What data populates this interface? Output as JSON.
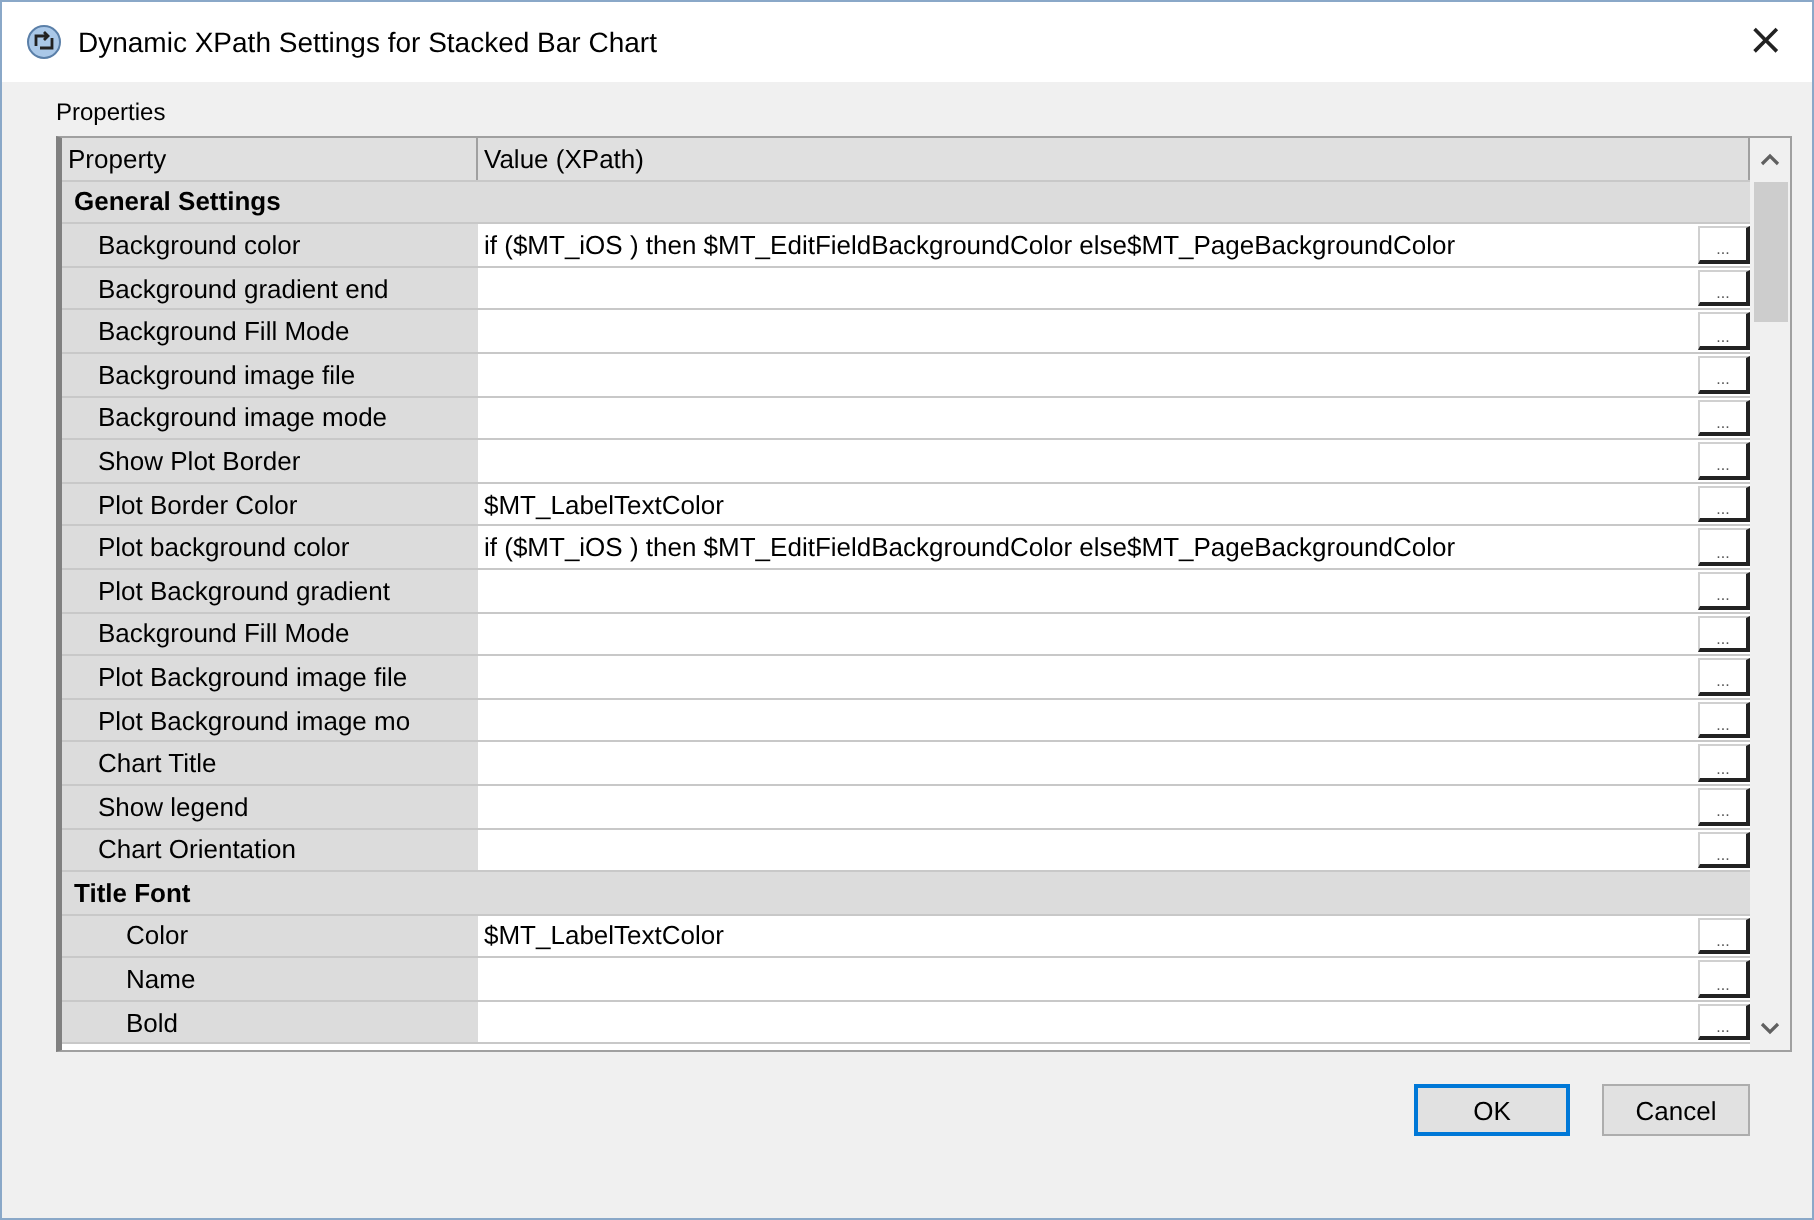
{
  "window": {
    "title": "Dynamic XPath Settings for Stacked Bar Chart",
    "close": "×"
  },
  "panel_label": "Properties",
  "table": {
    "columns": [
      "Property",
      "Value (XPath)"
    ],
    "sections": [
      {
        "title": "General Settings",
        "children": [
          {
            "property": "Background color",
            "value": "if ($MT_iOS ) then $MT_EditFieldBackgroundColor else$MT_PageBackgroundColor",
            "button": "..."
          },
          {
            "property": "Background gradient end",
            "button": "..."
          },
          {
            "property": "Background Fill Mode",
            "button": "..."
          },
          {
            "property": "Background image file",
            "button": "..."
          },
          {
            "property": "Background image mode",
            "button": "..."
          },
          {
            "property": "Show Plot Border",
            "button": "..."
          },
          {
            "property": "Plot Border Color",
            "value": "$MT_LabelTextColor",
            "button": "..."
          },
          {
            "property": "Plot background color",
            "value": "if ($MT_iOS ) then $MT_EditFieldBackgroundColor else$MT_PageBackgroundColor",
            "button": "..."
          },
          {
            "property": "Plot Background gradient",
            "button": "..."
          },
          {
            "property": "Background Fill Mode",
            "button": "..."
          },
          {
            "property": "Plot Background image file",
            "button": "..."
          },
          {
            "property": "Plot Background image mo",
            "button": "..."
          },
          {
            "property": "Chart Title",
            "button": "..."
          },
          {
            "property": "Show legend",
            "button": "..."
          },
          {
            "property": "Chart Orientation",
            "button": "..."
          }
        ]
      },
      {
        "title": "Title Font",
        "children": [
          {
            "property": "Color",
            "value": "$MT_LabelTextColor",
            "button": "..."
          },
          {
            "property": "Name",
            "button": "..."
          },
          {
            "property": "Bold",
            "button": "..."
          }
        ]
      }
    ]
  },
  "buttons": [
    {
      "label": "OK",
      "selected": true
    },
    {
      "label": "Cancel",
      "selected": false
    }
  ]
}
